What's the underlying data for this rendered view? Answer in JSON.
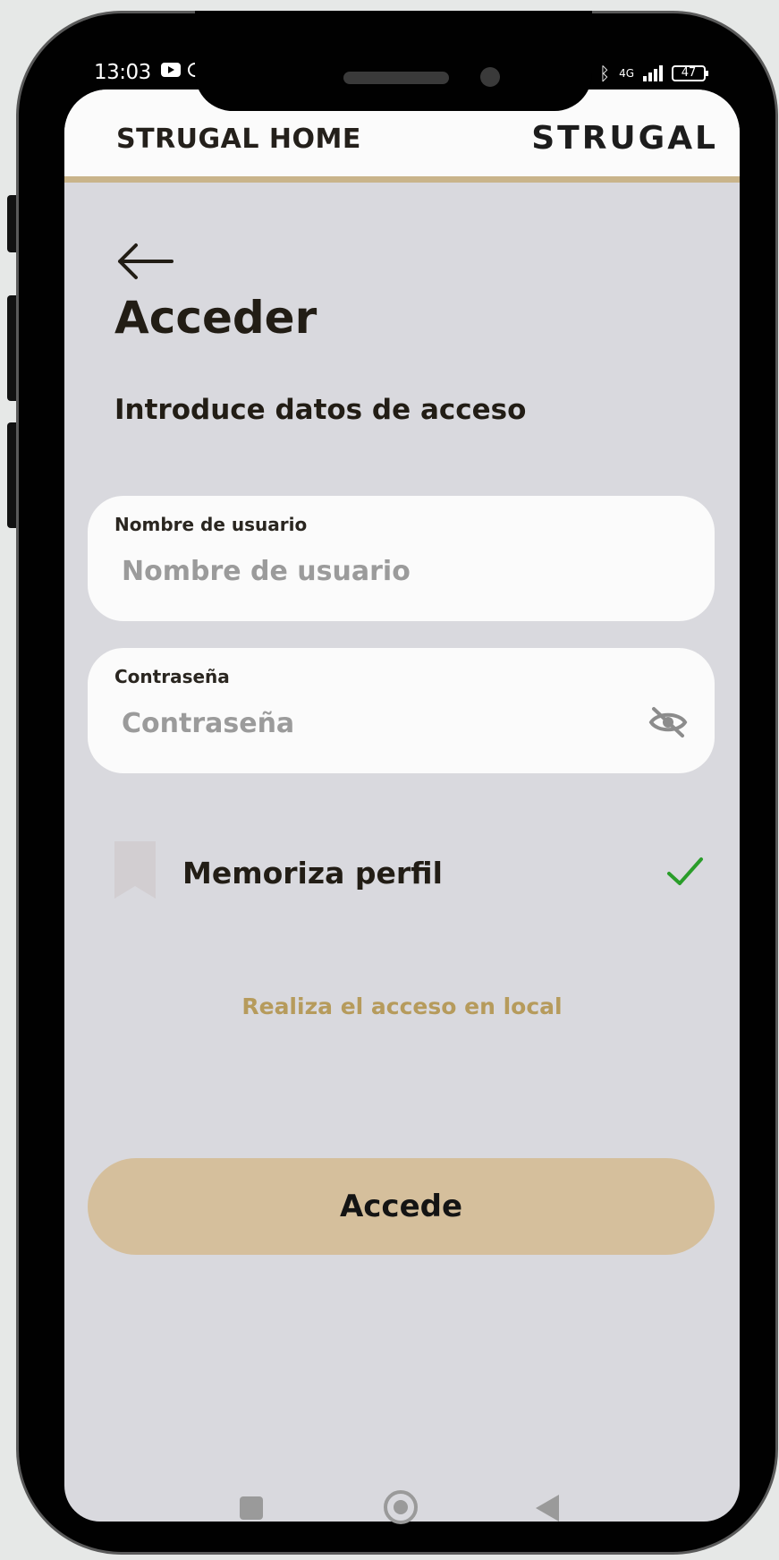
{
  "status_bar": {
    "time": "13:03",
    "network": "4G",
    "battery": "47"
  },
  "header": {
    "app_title": "STRUGAL HOME",
    "brand_logo": "STRUGAL"
  },
  "login": {
    "title": "Acceder",
    "subtitle": "Introduce datos de acceso",
    "username": {
      "label": "Nombre de usuario",
      "placeholder": "Nombre de usuario",
      "value": ""
    },
    "password": {
      "label": "Contraseña",
      "placeholder": "Contraseña",
      "value": "",
      "toggle_icon": "eye-off-icon"
    },
    "remember": {
      "label": "Memoriza perfil",
      "checked": true
    },
    "local_link": "Realiza el acceso en local",
    "submit_label": "Accede"
  },
  "colors": {
    "accent": "#c9b48a",
    "button": "#d5bf9c",
    "link": "#b69b5c",
    "check": "#2a9d2a",
    "background": "#d9d9de"
  }
}
